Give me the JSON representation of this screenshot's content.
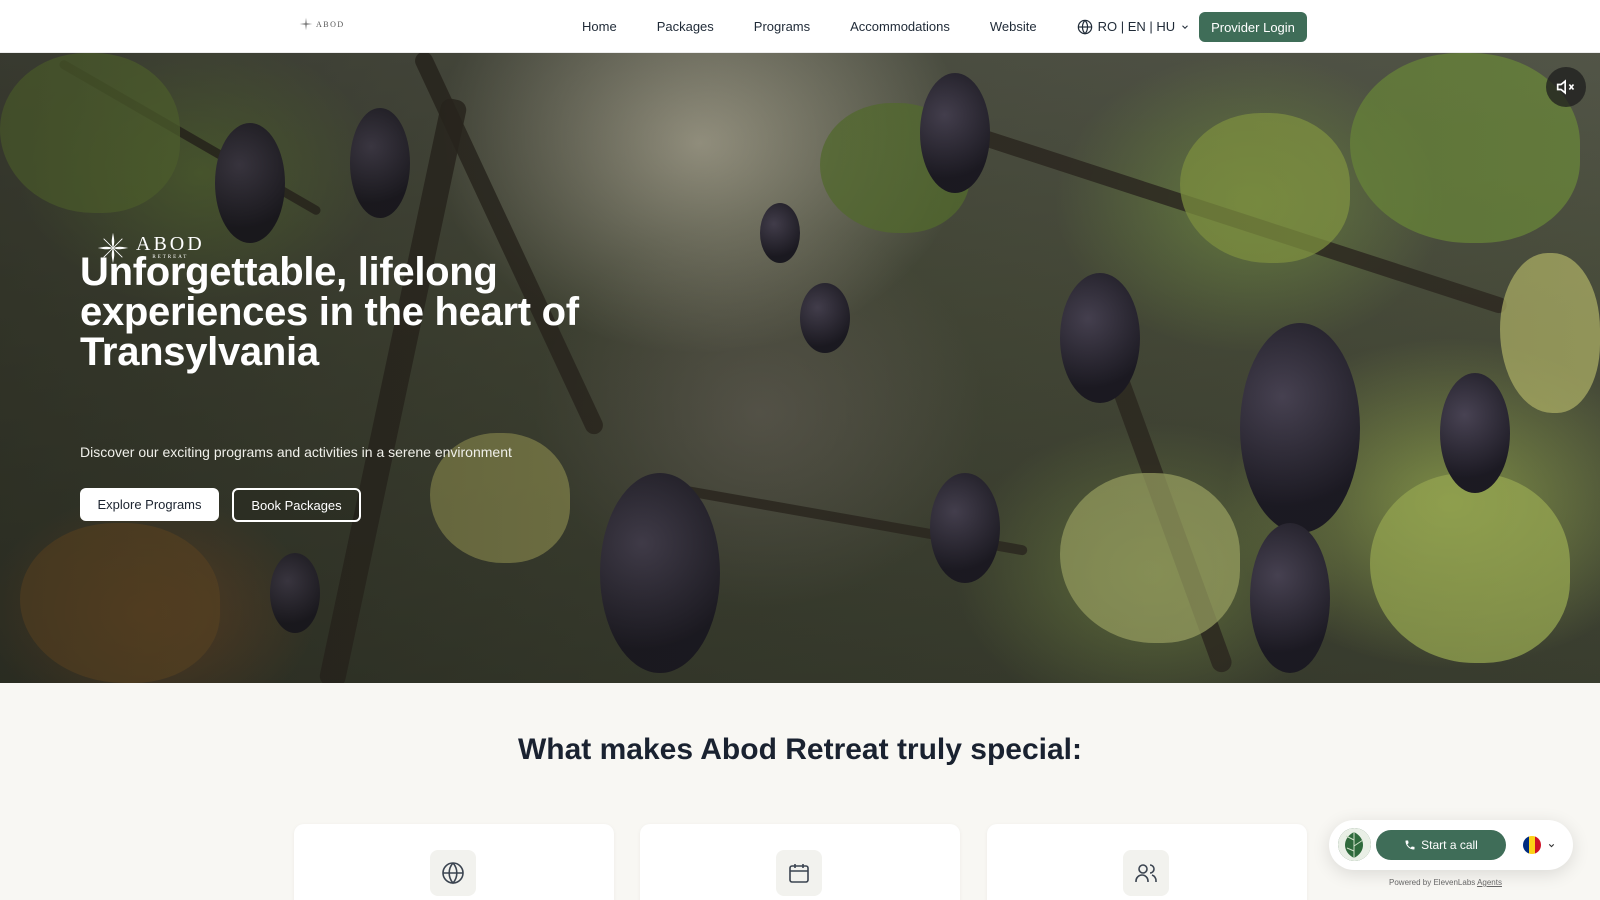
{
  "nav": {
    "logo_text": "ABOD",
    "links": [
      "Home",
      "Packages",
      "Programs",
      "Accommodations",
      "Website"
    ],
    "language": "RO | EN | HU",
    "provider_login": "Provider Login"
  },
  "hero": {
    "logo_text": "ABOD",
    "logo_subtext": "RETREAT",
    "title": "Unforgettable, lifelong experiences in the heart of Transylvania",
    "subtitle": "Discover our exciting programs and activities in a serene environment",
    "primary_button": "Explore Programs",
    "secondary_button": "Book Packages"
  },
  "section": {
    "title": "What makes Abod Retreat truly special:",
    "cards": [
      {
        "icon": "globe-icon"
      },
      {
        "icon": "calendar-icon"
      },
      {
        "icon": "users-icon"
      }
    ]
  },
  "widget": {
    "call_label": "Start a call",
    "powered_text": "Powered by ElevenLabs",
    "powered_link": "Agents"
  },
  "colors": {
    "accent": "#3f6d58",
    "heading": "#1a2230",
    "section_bg": "#f8f7f3"
  }
}
